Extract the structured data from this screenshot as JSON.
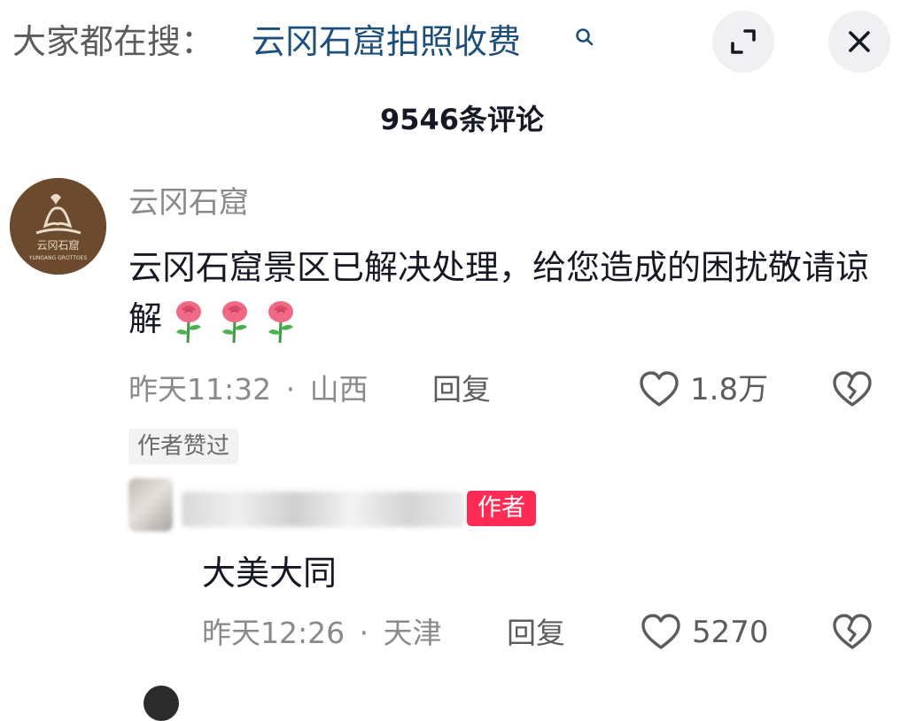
{
  "header": {
    "search_prefix": "大家都在搜：",
    "search_term": "云冈石窟拍照收费",
    "search_icon": "search-icon",
    "expand_icon": "expand-icon",
    "close_icon": "close-icon"
  },
  "comments_title": "9546条评论",
  "comment": {
    "username": "云冈石窟",
    "avatar_logo_text": "云冈石窟",
    "avatar_logo_subtext": "YUNGANG GROTTOES",
    "text": "云冈石窟景区已解决处理，给您造成的困扰敬请谅解",
    "emoji": "rose",
    "time": "昨天11:32",
    "separator": "·",
    "location": "山西",
    "reply_label": "回复",
    "likes": "1.8万",
    "author_liked_badge": "作者赞过"
  },
  "reply": {
    "author_badge": "作者",
    "text": "大美大同",
    "time": "昨天12:26",
    "separator": "·",
    "location": "天津",
    "reply_label": "回复",
    "likes": "5270"
  },
  "colors": {
    "accent_link": "#1d4f7c",
    "author_badge": "#fe2c55",
    "muted_text": "#8a8a8a",
    "avatar_bg": "#6b4a2e"
  }
}
